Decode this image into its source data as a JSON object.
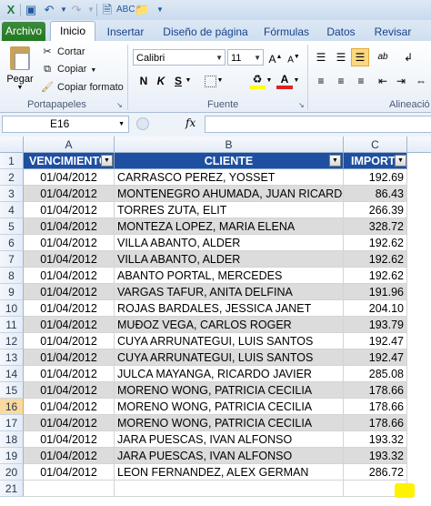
{
  "qat": {
    "icons": [
      "excel-icon",
      "save-icon",
      "undo-icon",
      "redo-icon",
      "print-preview-icon",
      "spelling-icon",
      "open-icon",
      "customize-icon"
    ]
  },
  "tabs": [
    "Archivo",
    "Inicio",
    "Insertar",
    "Diseño de página",
    "Fórmulas",
    "Datos",
    "Revisar"
  ],
  "ribbon": {
    "clipboard": {
      "paste": "Pegar",
      "cut": "Cortar",
      "copy": "Copiar",
      "format_painter": "Copiar formato",
      "group": "Portapapeles"
    },
    "font": {
      "name": "Calibri",
      "size": "11",
      "bold": "N",
      "italic": "K",
      "underline": "S",
      "group": "Fuente"
    },
    "alignment": {
      "group": "Alineació"
    }
  },
  "formula_bar": {
    "name_box": "E16",
    "fx": "fx",
    "value": ""
  },
  "columns": [
    "A",
    "B",
    "C"
  ],
  "header_row": {
    "row": "1",
    "a": "VENCIMIENTO",
    "b": "CLIENTE",
    "c": "IMPORTE"
  },
  "rows": [
    {
      "row": "2",
      "a": "01/04/2012",
      "b": "CARRASCO PEREZ, YOSSET",
      "c": "192.69"
    },
    {
      "row": "3",
      "a": "01/04/2012",
      "b": "MONTENEGRO AHUMADA, JUAN RICARDO",
      "c": "86.43"
    },
    {
      "row": "4",
      "a": "01/04/2012",
      "b": "TORRES ZUTA, ELIT",
      "c": "266.39"
    },
    {
      "row": "5",
      "a": "01/04/2012",
      "b": "MONTEZA LOPEZ, MARIA ELENA",
      "c": "328.72"
    },
    {
      "row": "6",
      "a": "01/04/2012",
      "b": "VILLA ABANTO, ALDER",
      "c": "192.62"
    },
    {
      "row": "7",
      "a": "01/04/2012",
      "b": "VILLA ABANTO, ALDER",
      "c": "192.62"
    },
    {
      "row": "8",
      "a": "01/04/2012",
      "b": "ABANTO PORTAL, MERCEDES",
      "c": "192.62"
    },
    {
      "row": "9",
      "a": "01/04/2012",
      "b": "VARGAS TAFUR, ANITA DELFINA",
      "c": "191.96"
    },
    {
      "row": "10",
      "a": "01/04/2012",
      "b": "ROJAS BARDALES, JESSICA JANET",
      "c": "204.10"
    },
    {
      "row": "11",
      "a": "01/04/2012",
      "b": "MUĐOZ VEGA, CARLOS ROGER",
      "c": "193.79"
    },
    {
      "row": "12",
      "a": "01/04/2012",
      "b": "CUYA ARRUNATEGUI, LUIS SANTOS",
      "c": "192.47"
    },
    {
      "row": "13",
      "a": "01/04/2012",
      "b": "CUYA ARRUNATEGUI, LUIS SANTOS",
      "c": "192.47"
    },
    {
      "row": "14",
      "a": "01/04/2012",
      "b": "JULCA MAYANGA, RICARDO JAVIER",
      "c": "285.08"
    },
    {
      "row": "15",
      "a": "01/04/2012",
      "b": "MORENO WONG, PATRICIA CECILIA",
      "c": "178.66"
    },
    {
      "row": "16",
      "a": "01/04/2012",
      "b": "MORENO WONG, PATRICIA CECILIA",
      "c": "178.66"
    },
    {
      "row": "17",
      "a": "01/04/2012",
      "b": "MORENO WONG, PATRICIA CECILIA",
      "c": "178.66"
    },
    {
      "row": "18",
      "a": "01/04/2012",
      "b": "JARA PUESCAS, IVAN ALFONSO",
      "c": "193.32"
    },
    {
      "row": "19",
      "a": "01/04/2012",
      "b": "JARA PUESCAS, IVAN ALFONSO",
      "c": "193.32"
    },
    {
      "row": "20",
      "a": "01/04/2012",
      "b": "LEON FERNANDEZ, ALEX GERMAN",
      "c": "286.72"
    },
    {
      "row": "21",
      "a": "",
      "b": "",
      "c": ""
    }
  ],
  "selected_row": "16",
  "colors": {
    "header_fill": "#1f4fa0",
    "band_fill": "#dcdcdc",
    "file_tab": "#217a21",
    "highlight_mark": "#fff200"
  }
}
